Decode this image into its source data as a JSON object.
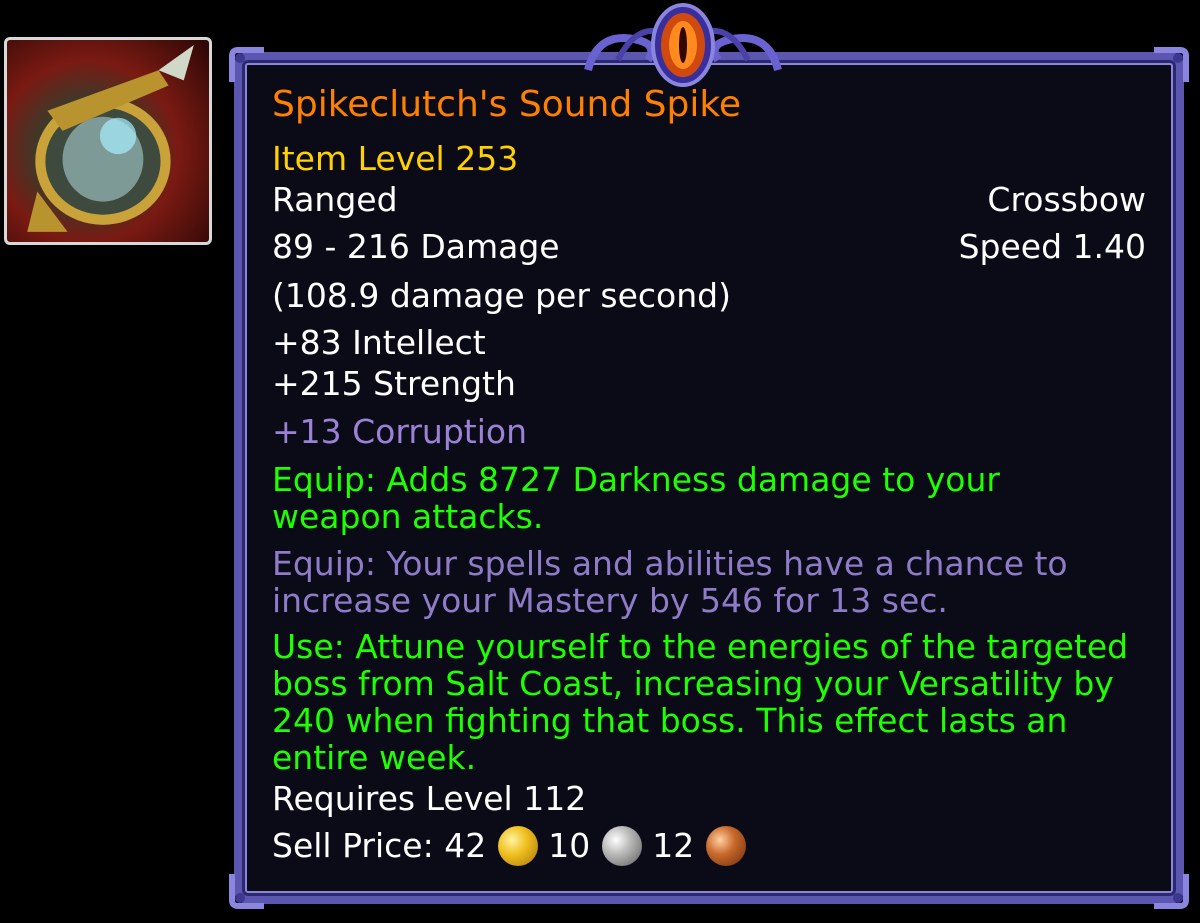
{
  "item": {
    "name": "Spikeclutch's Sound Spike",
    "item_level": "Item Level 253",
    "slot": "Ranged",
    "type": "Crossbow",
    "damage": "89 - 216 Damage",
    "speed": "Speed 1.40",
    "dps": "(108.9 damage per second)",
    "stats": [
      "+83 Intellect",
      "+215 Strength"
    ],
    "corruption": "+13 Corruption",
    "equip_1": "Equip: Adds 8727 Darkness damage to your weapon attacks.",
    "equip_2": "Equip: Your spells and abilities have a chance to increase your Mastery by 546 for 13 sec.",
    "use": "Use: Attune yourself to the energies of the targeted boss from Salt Coast, increasing your Versatility by 240 when fighting that boss. This effect lasts an entire week.",
    "requires": "Requires Level 112",
    "sell_price": {
      "label": "Sell Price:",
      "gold": "42",
      "silver": "10",
      "copper": "12"
    }
  },
  "colors": {
    "name": "#ff8000",
    "item_level": "#ffd100",
    "green_text": "#1eff00",
    "purple_text": "#8f7cc9",
    "border": "#5b56b0"
  },
  "icons": {
    "item_icon": "crossbow-item-icon",
    "gold": "gold-coin-icon",
    "silver": "silver-coin-icon",
    "copper": "copper-coin-icon",
    "ornament": "eye-ornament-icon"
  }
}
